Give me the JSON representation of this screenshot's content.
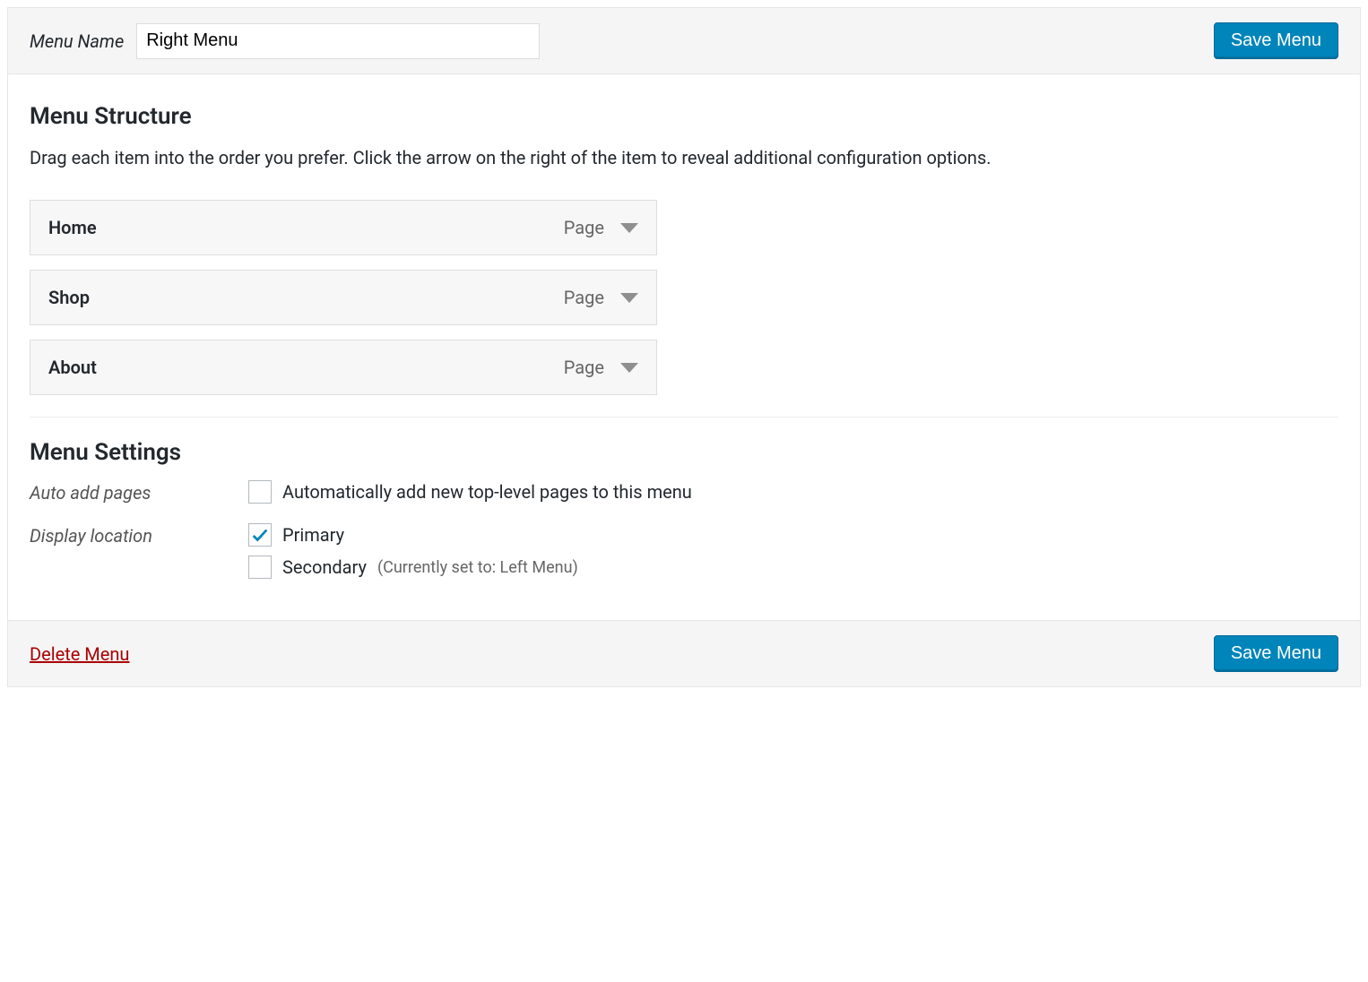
{
  "header": {
    "menu_name_label": "Menu Name",
    "menu_name_value": "Right Menu",
    "save_label": "Save Menu"
  },
  "structure": {
    "heading": "Menu Structure",
    "helper": "Drag each item into the order you prefer. Click the arrow on the right of the item to reveal additional configuration options.",
    "items": [
      {
        "title": "Home",
        "type": "Page"
      },
      {
        "title": "Shop",
        "type": "Page"
      },
      {
        "title": "About",
        "type": "Page"
      }
    ]
  },
  "settings": {
    "heading": "Menu Settings",
    "auto_add_label": "Auto add pages",
    "auto_add_option": "Automatically add new top-level pages to this menu",
    "auto_add_checked": false,
    "display_location_label": "Display location",
    "locations": [
      {
        "name": "Primary",
        "checked": true,
        "note": ""
      },
      {
        "name": "Secondary",
        "checked": false,
        "note": "(Currently set to: Left Menu)"
      }
    ]
  },
  "footer": {
    "delete_label": "Delete Menu",
    "save_label": "Save Menu"
  }
}
